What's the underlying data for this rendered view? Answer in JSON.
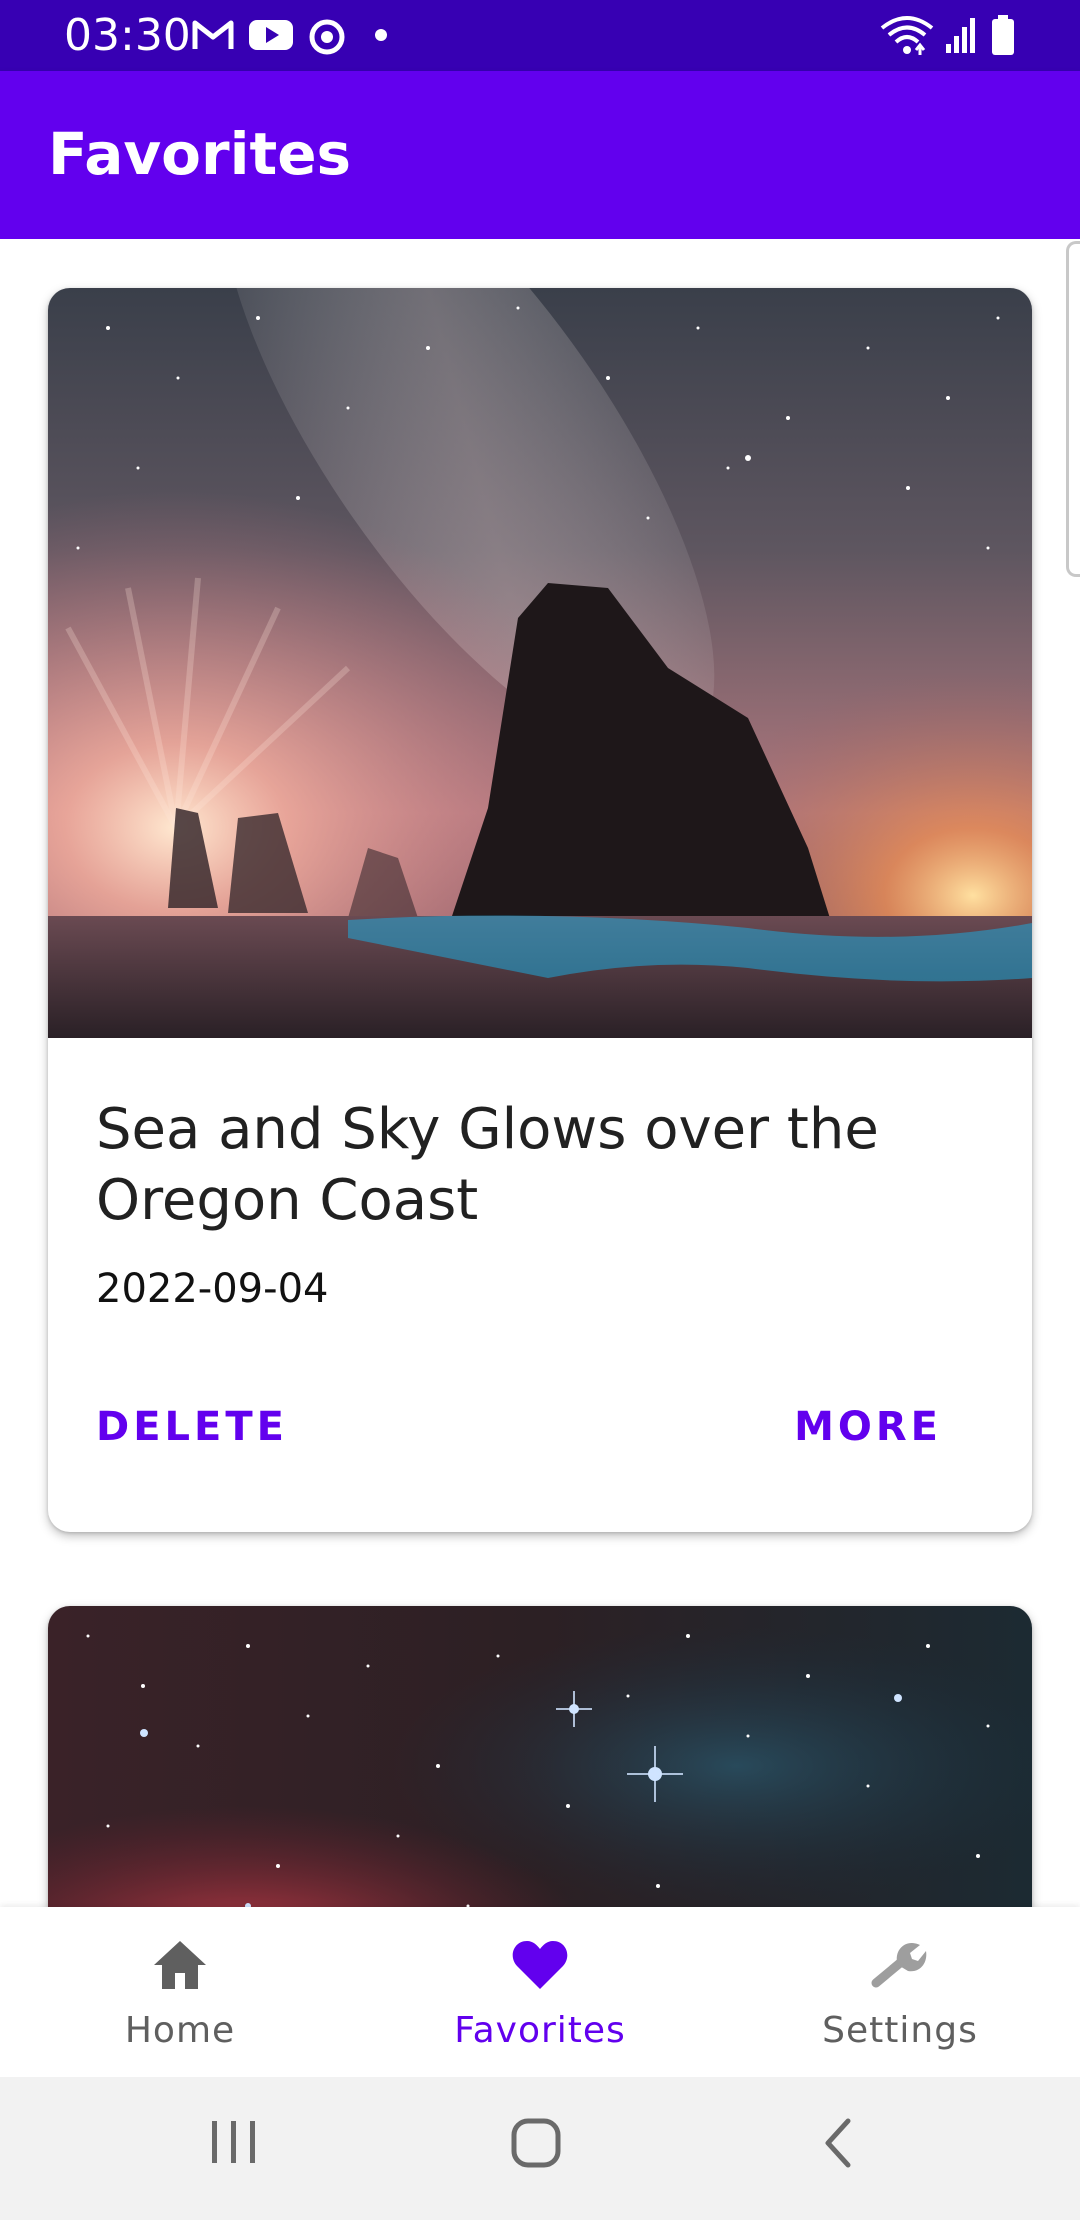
{
  "status_bar": {
    "time": "03:30",
    "left_icons": [
      "gmail-icon",
      "youtube-icon",
      "sync-icon",
      "dot-icon"
    ],
    "right_icons": [
      "wifi-icon",
      "signal-icon",
      "battery-icon"
    ]
  },
  "app_bar": {
    "title": "Favorites"
  },
  "cards": [
    {
      "title": "Sea and Sky Glows over the Oregon Coast",
      "date": "2022-09-04",
      "actions": {
        "delete": "DELETE",
        "more": "MORE"
      }
    }
  ],
  "bottom_nav": {
    "items": [
      {
        "label": "Home",
        "icon": "home-icon"
      },
      {
        "label": "Favorites",
        "icon": "heart-icon",
        "selected": true
      },
      {
        "label": "Settings",
        "icon": "wrench-icon"
      }
    ]
  },
  "colors": {
    "status_bar": "#3700b3",
    "primary": "#6200ee",
    "inactive": "#5f5f5f",
    "wrench_inactive": "#9e9e9e"
  },
  "system_nav": {
    "icons": [
      "recents-icon",
      "home-button-icon",
      "back-icon"
    ]
  }
}
